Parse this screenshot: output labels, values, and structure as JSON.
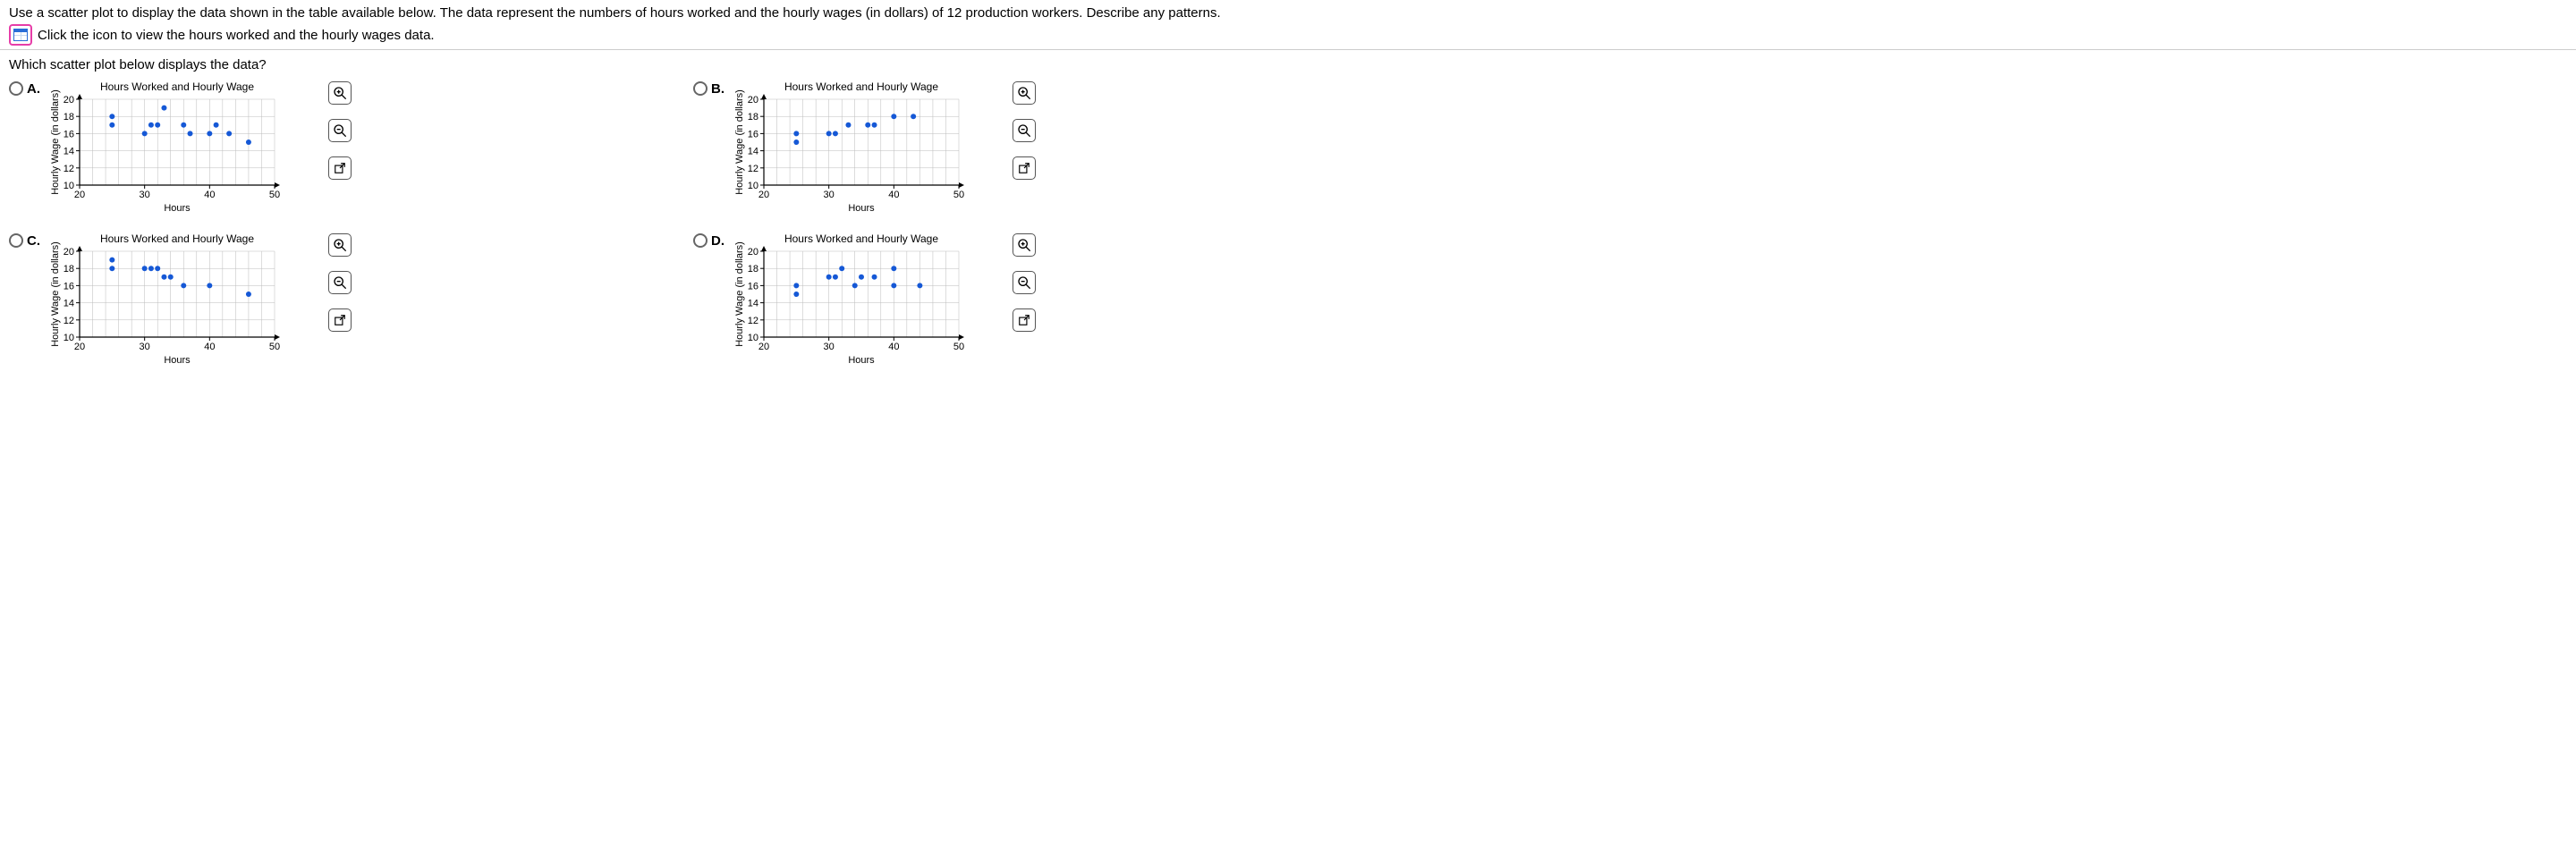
{
  "intro": "Use a scatter plot to display the data shown in the table available below. The data represent the numbers of hours worked and the hourly wages (in dollars) of 12 production workers. Describe any patterns.",
  "iconLine": "Click the icon to view the hours worked and the hourly wages data.",
  "question": "Which scatter plot below displays the data?",
  "choiceLabels": {
    "a": "A.",
    "b": "B.",
    "c": "C.",
    "d": "D."
  },
  "plotMeta": {
    "title": "Hours Worked and Hourly Wage",
    "xlabel": "Hours",
    "ylabel": "Hourly Wage (in dollars)",
    "xTicks": [
      "20",
      "30",
      "40",
      "50"
    ],
    "yTicks": [
      "10",
      "12",
      "14",
      "16",
      "18",
      "20"
    ]
  },
  "chart_data": [
    {
      "id": "A",
      "type": "scatter",
      "title": "Hours Worked and Hourly Wage",
      "xlabel": "Hours",
      "ylabel": "Hourly Wage (in dollars)",
      "xlim": [
        20,
        50
      ],
      "ylim": [
        10,
        20
      ],
      "points": [
        {
          "x": 25,
          "y": 17
        },
        {
          "x": 25,
          "y": 18
        },
        {
          "x": 30,
          "y": 16
        },
        {
          "x": 31,
          "y": 17
        },
        {
          "x": 32,
          "y": 17
        },
        {
          "x": 33,
          "y": 19
        },
        {
          "x": 36,
          "y": 17
        },
        {
          "x": 37,
          "y": 16
        },
        {
          "x": 40,
          "y": 16
        },
        {
          "x": 41,
          "y": 17
        },
        {
          "x": 43,
          "y": 16
        },
        {
          "x": 46,
          "y": 15
        }
      ]
    },
    {
      "id": "B",
      "type": "scatter",
      "title": "Hours Worked and Hourly Wage",
      "xlabel": "Hours",
      "ylabel": "Hourly Wage (in dollars)",
      "xlim": [
        20,
        50
      ],
      "ylim": [
        10,
        20
      ],
      "points": [
        {
          "x": 25,
          "y": 15
        },
        {
          "x": 25,
          "y": 16
        },
        {
          "x": 30,
          "y": 16
        },
        {
          "x": 31,
          "y": 16
        },
        {
          "x": 33,
          "y": 17
        },
        {
          "x": 36,
          "y": 17
        },
        {
          "x": 37,
          "y": 17
        },
        {
          "x": 40,
          "y": 18
        },
        {
          "x": 43,
          "y": 18
        }
      ]
    },
    {
      "id": "C",
      "type": "scatter",
      "title": "Hours Worked and Hourly Wage",
      "xlabel": "Hours",
      "ylabel": "Hourly Wage (in dollars)",
      "xlim": [
        20,
        50
      ],
      "ylim": [
        10,
        20
      ],
      "points": [
        {
          "x": 25,
          "y": 18
        },
        {
          "x": 25,
          "y": 19
        },
        {
          "x": 30,
          "y": 18
        },
        {
          "x": 31,
          "y": 18
        },
        {
          "x": 32,
          "y": 18
        },
        {
          "x": 33,
          "y": 17
        },
        {
          "x": 34,
          "y": 17
        },
        {
          "x": 36,
          "y": 16
        },
        {
          "x": 40,
          "y": 16
        },
        {
          "x": 46,
          "y": 15
        }
      ]
    },
    {
      "id": "D",
      "type": "scatter",
      "title": "Hours Worked and Hourly Wage",
      "xlabel": "Hours",
      "ylabel": "Hourly Wage (in dollars)",
      "xlim": [
        20,
        50
      ],
      "ylim": [
        10,
        20
      ],
      "points": [
        {
          "x": 25,
          "y": 15
        },
        {
          "x": 25,
          "y": 16
        },
        {
          "x": 30,
          "y": 17
        },
        {
          "x": 31,
          "y": 17
        },
        {
          "x": 32,
          "y": 18
        },
        {
          "x": 34,
          "y": 16
        },
        {
          "x": 35,
          "y": 17
        },
        {
          "x": 37,
          "y": 17
        },
        {
          "x": 40,
          "y": 18
        },
        {
          "x": 40,
          "y": 16
        },
        {
          "x": 44,
          "y": 16
        }
      ]
    }
  ]
}
